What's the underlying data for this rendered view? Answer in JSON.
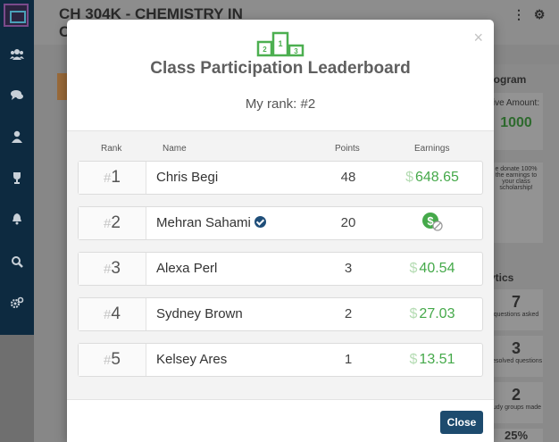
{
  "background": {
    "course_title_line1": "CH 304K - CHEMISTRY IN",
    "course_title_line2": "C",
    "program_heading": "rogram",
    "amount_label": "ive Amount:",
    "amount_value": "1000",
    "donate_text": "e donate 100% the earnings to your class scholarship!",
    "analytics_heading": "ytics",
    "stats": [
      {
        "value": "7",
        "label": "questions asked"
      },
      {
        "value": "3",
        "label": "resolved questions"
      },
      {
        "value": "2",
        "label": "tudy groups made"
      }
    ],
    "bottom_partial": "25%"
  },
  "modal": {
    "title": "Class Participation Leaderboard",
    "my_rank": "My rank: #2",
    "close_x": "×",
    "columns": {
      "rank": "Rank",
      "name": "Name",
      "points": "Points",
      "earnings": "Earnings"
    },
    "rows": [
      {
        "hash": "#",
        "rank": "1",
        "name": "Chris Begi",
        "points": "48",
        "currency": "$",
        "earnings": "648.65",
        "verified": false,
        "earnings_icon": false
      },
      {
        "hash": "#",
        "rank": "2",
        "name": "Mehran Sahami",
        "points": "20",
        "currency": "",
        "earnings": "",
        "verified": true,
        "earnings_icon": true
      },
      {
        "hash": "#",
        "rank": "3",
        "name": "Alexa Perl",
        "points": "3",
        "currency": "$",
        "earnings": "40.54",
        "verified": false,
        "earnings_icon": false
      },
      {
        "hash": "#",
        "rank": "4",
        "name": "Sydney Brown",
        "points": "2",
        "currency": "$",
        "earnings": "27.03",
        "verified": false,
        "earnings_icon": false
      },
      {
        "hash": "#",
        "rank": "5",
        "name": "Kelsey Ares",
        "points": "1",
        "currency": "$",
        "earnings": "13.51",
        "verified": false,
        "earnings_icon": false
      }
    ],
    "close_button": "Close"
  },
  "colors": {
    "accent_green": "#45a94a",
    "button_blue": "#1d4b6e",
    "sidebar": "#0d2a40"
  },
  "icons": [
    "podium-icon",
    "verified-check-icon",
    "no-money-icon",
    "users-icon",
    "chat-icon",
    "user-icon",
    "trophy-icon",
    "bell-icon",
    "search-icon",
    "gears-icon"
  ]
}
